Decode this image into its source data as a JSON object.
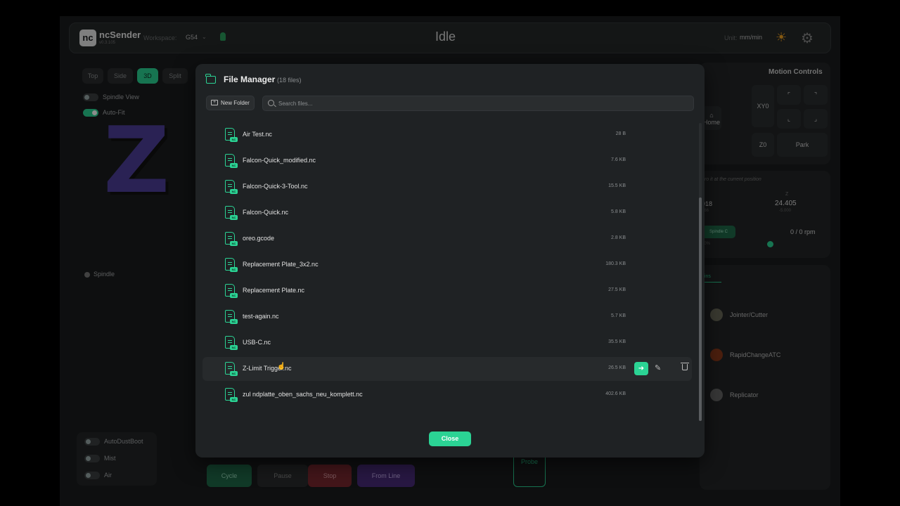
{
  "header": {
    "logo_text": "nc",
    "app_name": "ncSender",
    "app_version": "v0.3.105",
    "workspace_label": "Workspace:",
    "workspace_value": "G54",
    "machine_state": "Idle",
    "unit_label": "Unit:",
    "unit_value": "mm/min"
  },
  "view": {
    "tabs": [
      "Top",
      "Side",
      "3D",
      "Split"
    ],
    "active_tab": "3D",
    "spindle_view_label": "Spindle View",
    "auto_fit_label": "Auto-Fit",
    "axis_letter": "Z",
    "spindle_label": "Spindle",
    "toggles": [
      "AutoDustBoot",
      "Mist",
      "Air"
    ]
  },
  "controls": {
    "cycle_label": "Cycle",
    "pause_label": "Pause",
    "stop_label": "Stop",
    "from_line_label": "From Line",
    "probe_label": "Probe"
  },
  "right_panel": {
    "title": "Motion Controls",
    "home_label": "Home",
    "xy0_label": "XY0",
    "z0_label": "Z0",
    "park_label": "Park",
    "zero_hint": "ero it at the current position",
    "y_value": "018",
    "y_sub": "466",
    "z_label": "Z",
    "z_value": "24.405",
    "z_sub": "-5.000",
    "spindle_btn": "Spindle C",
    "spindle_pct": "00%",
    "rpm": "0 / 0 rpm",
    "plugins_tab": "gins",
    "plugins": [
      "Jointer/Cutter",
      "RapidChangeATC",
      "Replicator"
    ]
  },
  "file_manager": {
    "title": "File Manager",
    "count": "(18 files)",
    "new_folder_label": "New Folder",
    "search_placeholder": "Search files...",
    "file_badge": "NC",
    "files": [
      {
        "name": "Air Test.nc",
        "size": "28 B"
      },
      {
        "name": "Falcon-Quick_modified.nc",
        "size": "7.6 KB"
      },
      {
        "name": "Falcon-Quick-3-Tool.nc",
        "size": "15.5 KB"
      },
      {
        "name": "Falcon-Quick.nc",
        "size": "5.8 KB"
      },
      {
        "name": "oreo.gcode",
        "size": "2.8 KB"
      },
      {
        "name": "Replacement Plate_3x2.nc",
        "size": "180.3 KB"
      },
      {
        "name": "Replacement Plate.nc",
        "size": "27.5 KB"
      },
      {
        "name": "test-again.nc",
        "size": "5.7 KB"
      },
      {
        "name": "USB-C.nc",
        "size": "35.5 KB"
      },
      {
        "name": "Z-Limit Trigger.nc",
        "size": "26.5 KB"
      },
      {
        "name": "zul ndplatte_oben_sachs_neu_komplett.nc",
        "size": "402.6 KB"
      }
    ],
    "close_label": "Close"
  },
  "colors": {
    "accent": "#2bd394",
    "background": "#1b1d1e",
    "modal": "#1f2224"
  }
}
